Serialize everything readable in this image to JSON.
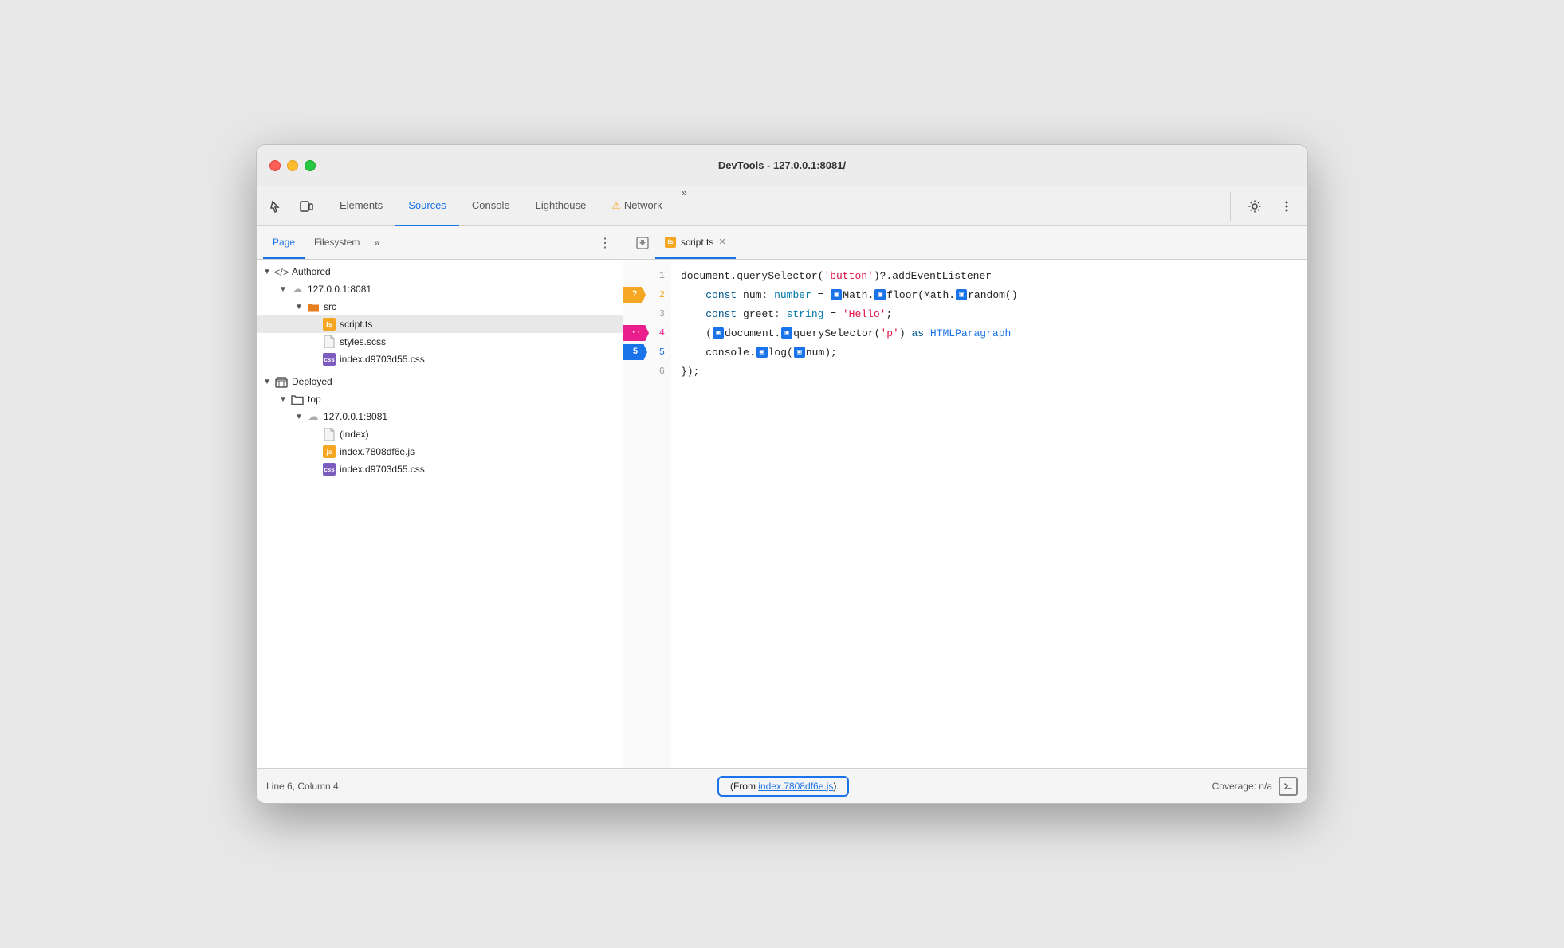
{
  "window": {
    "title": "DevTools - 127.0.0.1:8081/"
  },
  "toolbar": {
    "tabs": [
      {
        "id": "elements",
        "label": "Elements",
        "active": false
      },
      {
        "id": "sources",
        "label": "Sources",
        "active": true
      },
      {
        "id": "console",
        "label": "Console",
        "active": false
      },
      {
        "id": "lighthouse",
        "label": "Lighthouse",
        "active": false
      },
      {
        "id": "network",
        "label": "Network",
        "active": false
      }
    ],
    "more_label": "»",
    "network_warning": "⚠"
  },
  "file_panel": {
    "tabs": [
      {
        "id": "page",
        "label": "Page",
        "active": true
      },
      {
        "id": "filesystem",
        "label": "Filesystem",
        "active": false
      }
    ],
    "more_label": "»",
    "tree": [
      {
        "indent": 1,
        "arrow": "▼",
        "icon": "code",
        "label": "Authored"
      },
      {
        "indent": 2,
        "arrow": "▼",
        "icon": "cloud",
        "label": "127.0.0.1:8081"
      },
      {
        "indent": 3,
        "arrow": "▼",
        "icon": "folder",
        "label": "src"
      },
      {
        "indent": 4,
        "arrow": "",
        "icon": "ts",
        "label": "script.ts",
        "selected": true
      },
      {
        "indent": 4,
        "arrow": "",
        "icon": "scss",
        "label": "styles.scss"
      },
      {
        "indent": 4,
        "arrow": "",
        "icon": "css",
        "label": "index.d9703d55.css"
      },
      {
        "indent": 1,
        "arrow": "▼",
        "icon": "box",
        "label": "Deployed"
      },
      {
        "indent": 2,
        "arrow": "▼",
        "icon": "folder-outline",
        "label": "top"
      },
      {
        "indent": 3,
        "arrow": "▼",
        "icon": "cloud",
        "label": "127.0.0.1:8081"
      },
      {
        "indent": 4,
        "arrow": "",
        "icon": "index",
        "label": "(index)"
      },
      {
        "indent": 4,
        "arrow": "",
        "icon": "js",
        "label": "index.7808df6e.js"
      },
      {
        "indent": 4,
        "arrow": "",
        "icon": "css",
        "label": "index.d9703d55.css"
      }
    ]
  },
  "editor": {
    "tab_filename": "script.ts",
    "lines": [
      {
        "num": 1,
        "badge": null,
        "code": "document.querySelector('button')?.addEventListener"
      },
      {
        "num": 2,
        "badge": "question",
        "badge_label": "?",
        "code": "    const num: number = ▣Math.▣floor(Math.▣random()"
      },
      {
        "num": 3,
        "badge": null,
        "code": "    const greet: string = 'Hello';"
      },
      {
        "num": 4,
        "badge": "dots",
        "badge_label": "..",
        "code": "    (▣document.▣querySelector('p') as HTMLParagraph"
      },
      {
        "num": 5,
        "badge": "blue",
        "badge_label": "5",
        "code": "    console.▣log(▣num);"
      },
      {
        "num": 6,
        "badge": null,
        "code": "});"
      }
    ]
  },
  "statusbar": {
    "position": "Line 6, Column 4",
    "source_label": "(From index.7808df6e.js)",
    "source_link_text": "index.7808df6e.js",
    "coverage": "Coverage: n/a"
  }
}
